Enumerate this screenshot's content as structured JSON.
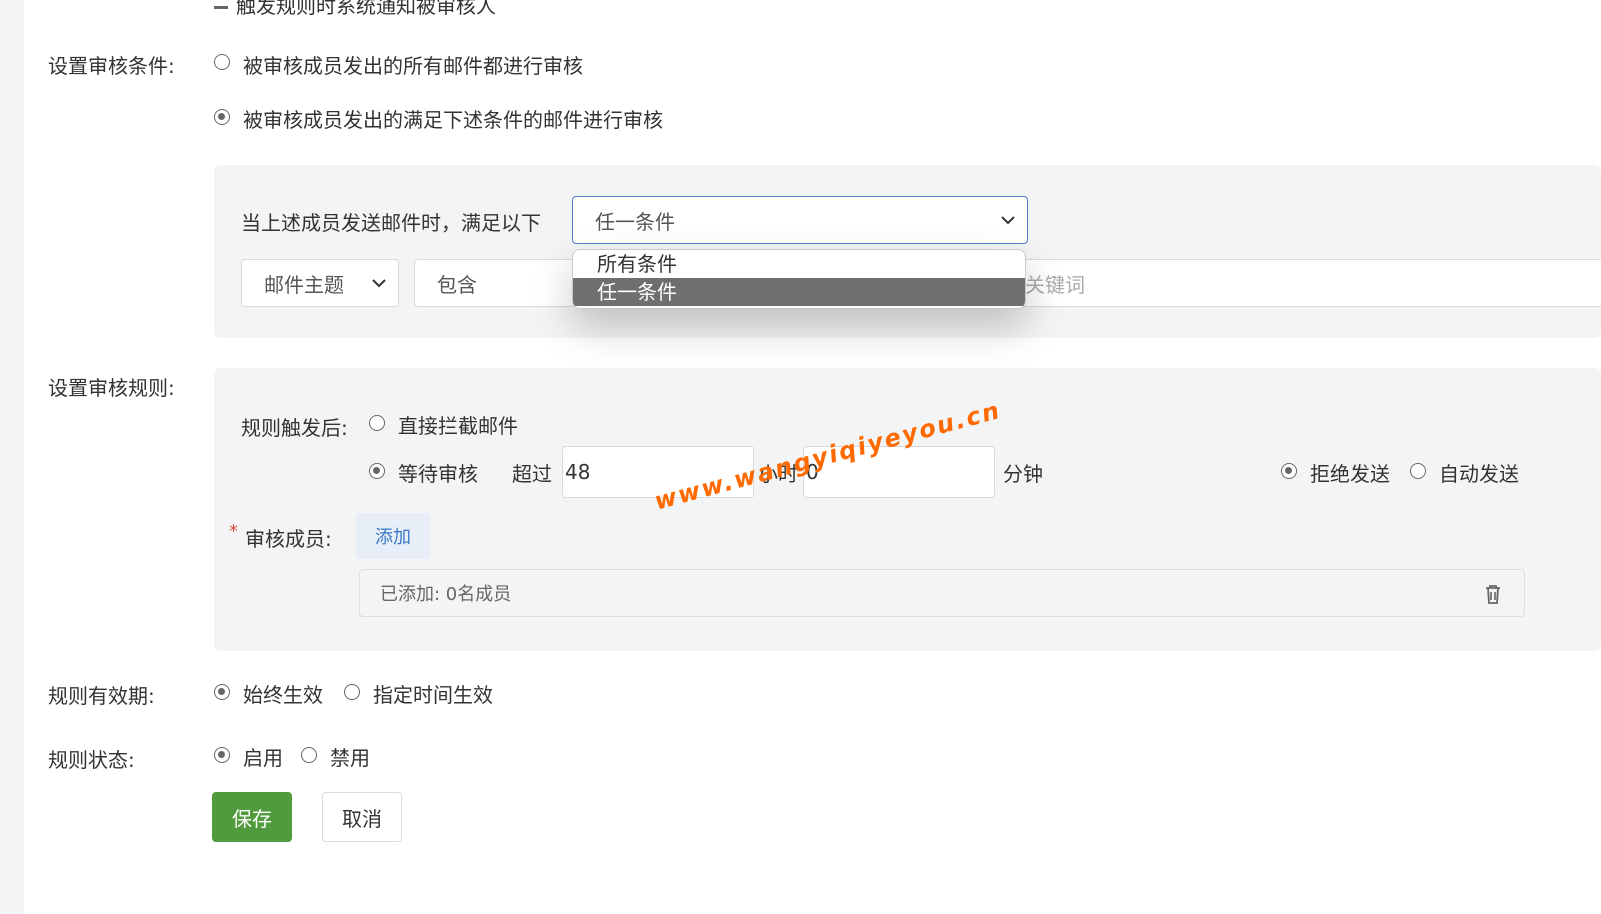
{
  "top_cut_text": "触发规则时系统通知被审核人",
  "audit_condition": {
    "label": "设置审核条件:",
    "option_all": "被审核成员发出的所有邮件都进行审核",
    "option_match": "被审核成员发出的满足下述条件的邮件进行审核",
    "selected": "option_match",
    "condition_prefix": "当上述成员发送邮件时，满足以下",
    "match_select_value": "任一条件",
    "dropdown_options": [
      "所有条件",
      "任一条件"
    ],
    "dropdown_selected_index": 1,
    "field_select_value": "邮件主题",
    "operator_value": "包含",
    "keyword_placeholder": "关键词"
  },
  "audit_rule": {
    "label": "设置审核规则:",
    "trigger_label": "规则触发后:",
    "option_block": "直接拦截邮件",
    "option_wait": "等待审核",
    "selected": "option_wait",
    "exceed_label": "超过",
    "hours_value": "48",
    "hours_unit": "小时",
    "minutes_value": "0",
    "minutes_unit": "分钟",
    "after_option_reject": "拒绝发送",
    "after_option_auto": "自动发送",
    "after_selected": "after_option_reject",
    "required_mark": "*",
    "reviewers_label": "审核成员:",
    "add_button": "添加",
    "added_text": "已添加: 0名成员"
  },
  "validity": {
    "label": "规则有效期:",
    "option_always": "始终生效",
    "option_specified": "指定时间生效",
    "selected": "option_always"
  },
  "status": {
    "label": "规则状态:",
    "option_enable": "启用",
    "option_disable": "禁用",
    "selected": "option_enable"
  },
  "actions": {
    "save": "保存",
    "cancel": "取消"
  },
  "watermark": "www.wangyiqiyeyou.cn",
  "colors": {
    "primary_green": "#4f9b3d",
    "link_blue": "#3a78c8",
    "panel_bg": "#f3f4f6",
    "watermark": "#ff6a00"
  }
}
